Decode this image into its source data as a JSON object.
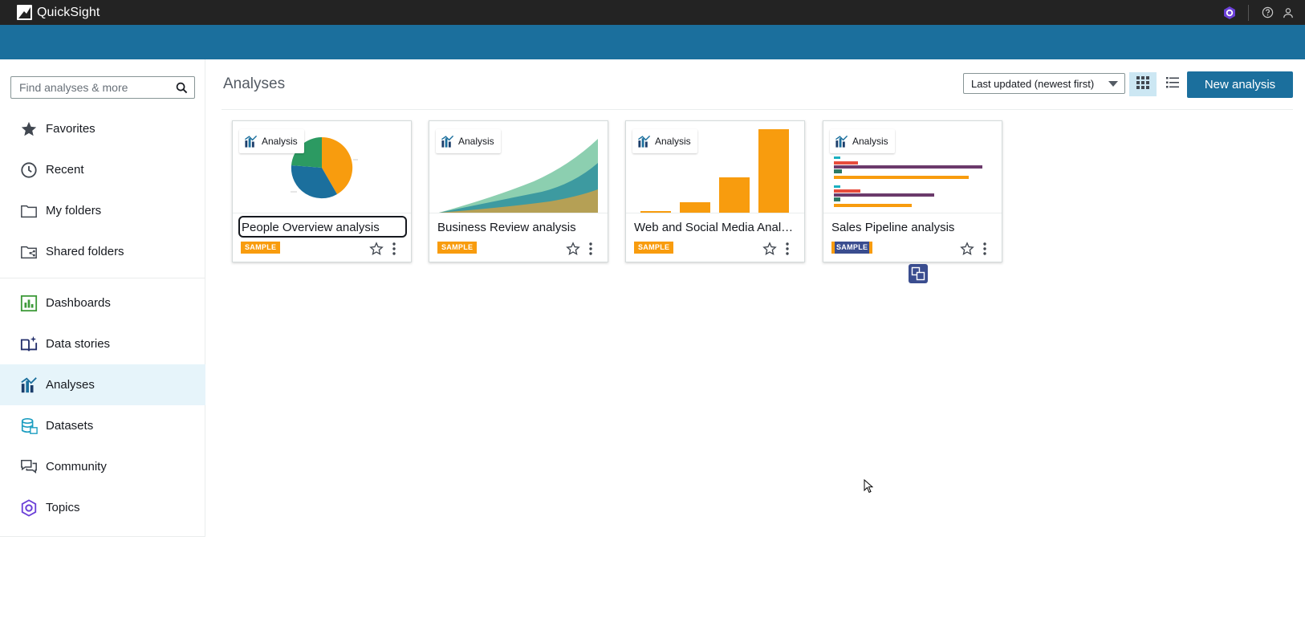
{
  "app": {
    "brand": "QuickSight"
  },
  "search": {
    "placeholder": "Find analyses & more"
  },
  "sidebar": {
    "items": [
      {
        "label": "Favorites",
        "icon": "star-icon"
      },
      {
        "label": "Recent",
        "icon": "clock-icon"
      },
      {
        "label": "My folders",
        "icon": "folder-icon"
      },
      {
        "label": "Shared folders",
        "icon": "shared-folder-icon"
      },
      {
        "label": "Dashboards",
        "icon": "dashboard-icon"
      },
      {
        "label": "Data stories",
        "icon": "data-story-icon"
      },
      {
        "label": "Analyses",
        "icon": "analysis-icon",
        "active": true
      },
      {
        "label": "Datasets",
        "icon": "dataset-icon"
      },
      {
        "label": "Community",
        "icon": "community-icon"
      },
      {
        "label": "Topics",
        "icon": "topics-icon"
      }
    ]
  },
  "main": {
    "title": "Analyses",
    "sort_value": "Last updated (newest first)",
    "new_button": "New analysis",
    "cards": [
      {
        "tag": "Analysis",
        "title": "People Overview analysis",
        "badge": "SAMPLE",
        "thumbnail": "pie-chart"
      },
      {
        "tag": "Analysis",
        "title": "Business Review analysis",
        "badge": "SAMPLE",
        "thumbnail": "area-chart"
      },
      {
        "tag": "Analysis",
        "title": "Web and Social Media Analytics analysis",
        "badge": "SAMPLE",
        "thumbnail": "bar-chart"
      },
      {
        "tag": "Analysis",
        "title": "Sales Pipeline analysis",
        "badge": "SAMPLE",
        "thumbnail": "horizontal-bar-chart"
      }
    ]
  },
  "colors": {
    "topbar": "#232323",
    "header_band": "#1b6f9d",
    "primary_button": "#1b6f9d",
    "active_nav": "#e6f4fa",
    "sample_badge": "#f89c0e"
  }
}
